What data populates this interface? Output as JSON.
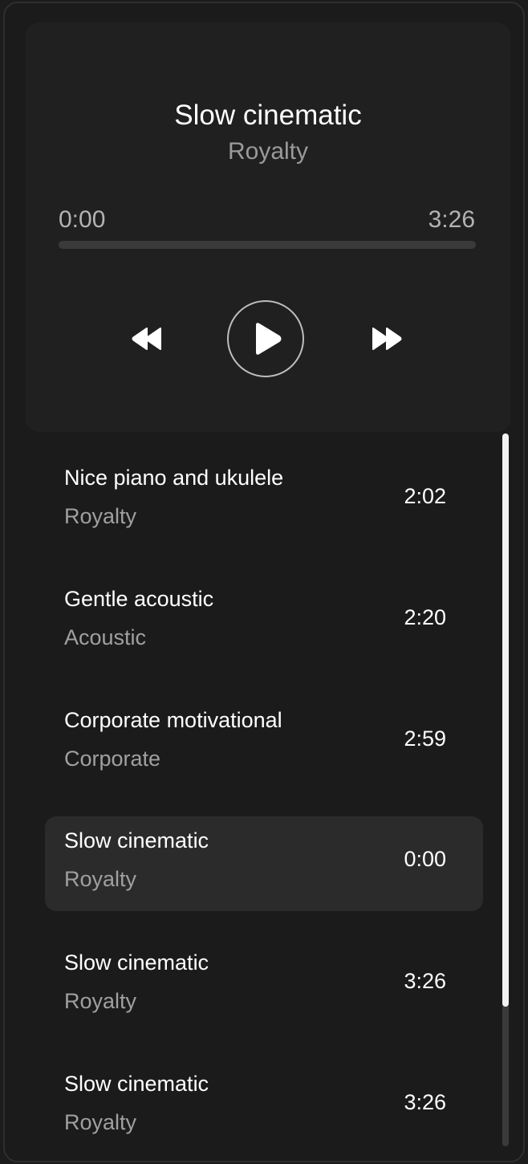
{
  "player": {
    "title": "Slow cinematic",
    "artist": "Royalty",
    "time_current": "0:00",
    "time_total": "3:26",
    "progress_fraction": 0
  },
  "controls": {
    "rewind_icon": "rewind-icon",
    "play_icon": "play-icon",
    "forward_icon": "fast-forward-icon"
  },
  "tracks": [
    {
      "title": "Nice piano and ukulele",
      "artist": "Royalty",
      "duration": "2:02",
      "active": false
    },
    {
      "title": "Gentle acoustic",
      "artist": "Acoustic",
      "duration": "2:20",
      "active": false
    },
    {
      "title": "Corporate motivational",
      "artist": "Corporate",
      "duration": "2:59",
      "active": false
    },
    {
      "title": "Slow cinematic",
      "artist": "Royalty",
      "duration": "0:00",
      "active": true
    },
    {
      "title": "Slow cinematic",
      "artist": "Royalty",
      "duration": "3:26",
      "active": false
    },
    {
      "title": "Slow cinematic",
      "artist": "Royalty",
      "duration": "3:26",
      "active": false
    }
  ],
  "colors": {
    "background": "#1b1b1b",
    "panel": "#202020",
    "active_row": "#2b2b2b",
    "text_primary": "#ffffff",
    "text_secondary": "#9a9a9a"
  }
}
